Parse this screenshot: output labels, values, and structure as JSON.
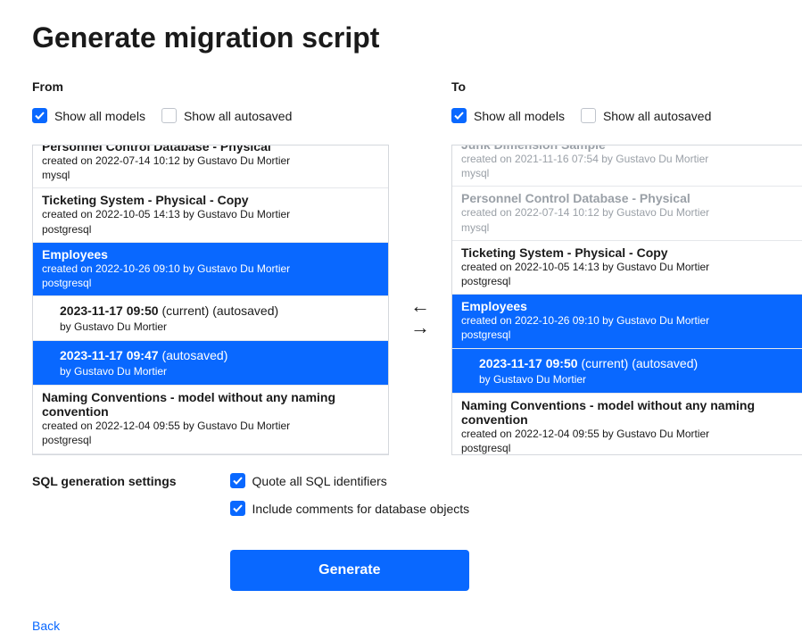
{
  "title": "Generate migration script",
  "from": {
    "label": "From",
    "show_all_models_label": "Show all models",
    "show_all_autosaved_label": "Show all autosaved",
    "show_all_models_checked": true,
    "show_all_autosaved_checked": false,
    "items": [
      {
        "name": "Personnel Control Database - Physical",
        "meta": "created on 2022-07-14 10:12 by Gustavo Du Mortier",
        "db": "mysql",
        "selected": false,
        "faded": false
      },
      {
        "name": "Ticketing System - Physical - Copy",
        "meta": "created on 2022-10-05 14:13 by Gustavo Du Mortier",
        "db": "postgresql",
        "selected": false,
        "faded": false
      },
      {
        "name": "Employees",
        "meta": "created on 2022-10-26 09:10 by Gustavo Du Mortier",
        "db": "postgresql",
        "selected": true,
        "faded": false,
        "children": [
          {
            "timestamp": "2023-11-17 09:50",
            "suffix": "(current) (autosaved)",
            "by": "by Gustavo Du Mortier",
            "selected": false
          },
          {
            "timestamp": "2023-11-17 09:47",
            "suffix": "(autosaved)",
            "by": "by Gustavo Du Mortier",
            "selected": true
          }
        ]
      },
      {
        "name": "Naming Conventions - model without any naming convention",
        "meta": "created on 2022-12-04 09:55 by Gustavo Du Mortier",
        "db": "postgresql",
        "selected": false,
        "faded": false
      }
    ]
  },
  "to": {
    "label": "To",
    "show_all_models_label": "Show all models",
    "show_all_autosaved_label": "Show all autosaved",
    "show_all_models_checked": true,
    "show_all_autosaved_checked": false,
    "items": [
      {
        "name": "Junk Dimension Sample",
        "meta": "created on 2021-11-16 07:54 by Gustavo Du Mortier",
        "db": "mysql",
        "selected": false,
        "faded": true
      },
      {
        "name": "Personnel Control Database - Physical",
        "meta": "created on 2022-07-14 10:12 by Gustavo Du Mortier",
        "db": "mysql",
        "selected": false,
        "faded": true
      },
      {
        "name": "Ticketing System - Physical - Copy",
        "meta": "created on 2022-10-05 14:13 by Gustavo Du Mortier",
        "db": "postgresql",
        "selected": false,
        "faded": false
      },
      {
        "name": "Employees",
        "meta": "created on 2022-10-26 09:10 by Gustavo Du Mortier",
        "db": "postgresql",
        "selected": true,
        "faded": false,
        "children": [
          {
            "timestamp": "2023-11-17 09:50",
            "suffix": "(current) (autosaved)",
            "by": "by Gustavo Du Mortier",
            "selected": true
          }
        ]
      },
      {
        "name": "Naming Conventions - model without any naming convention",
        "meta": "created on 2022-12-04 09:55 by Gustavo Du Mortier",
        "db": "postgresql",
        "selected": false,
        "faded": false
      }
    ]
  },
  "settings": {
    "label": "SQL generation settings",
    "quote_identifiers_label": "Quote all SQL identifiers",
    "quote_identifiers_checked": true,
    "include_comments_label": "Include comments for database objects",
    "include_comments_checked": true
  },
  "generate_label": "Generate",
  "back_label": "Back"
}
